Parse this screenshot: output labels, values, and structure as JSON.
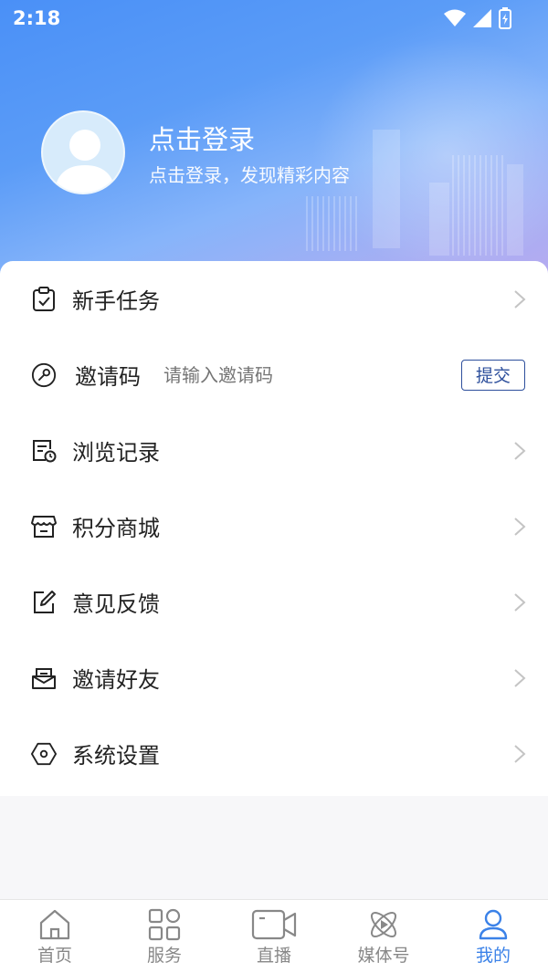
{
  "status_bar": {
    "time": "2:18"
  },
  "profile": {
    "title": "点击登录",
    "subtitle": "点击登录，发现精彩内容"
  },
  "menu": {
    "items": [
      {
        "label": "新手任务",
        "icon": "clipboard-check-icon"
      },
      {
        "label": "邀请码",
        "icon": "key-icon",
        "input_placeholder": "请输入邀请码",
        "button": "提交"
      },
      {
        "label": "浏览记录",
        "icon": "history-doc-icon"
      },
      {
        "label": "积分商城",
        "icon": "shop-icon"
      },
      {
        "label": "意见反馈",
        "icon": "edit-icon"
      },
      {
        "label": "邀请好友",
        "icon": "mail-icon"
      },
      {
        "label": "系统设置",
        "icon": "settings-hex-icon"
      }
    ]
  },
  "tabbar": {
    "items": [
      {
        "label": "首页",
        "icon": "home-icon"
      },
      {
        "label": "服务",
        "icon": "grid-icon"
      },
      {
        "label": "直播",
        "icon": "video-icon"
      },
      {
        "label": "媒体号",
        "icon": "atom-play-icon"
      },
      {
        "label": "我的",
        "icon": "user-icon",
        "active": true
      }
    ]
  },
  "colors": {
    "accent": "#3b82e8",
    "submit_border": "#2d4f9c",
    "header_start": "#4a90f7",
    "header_end": "#b9a9ef"
  }
}
